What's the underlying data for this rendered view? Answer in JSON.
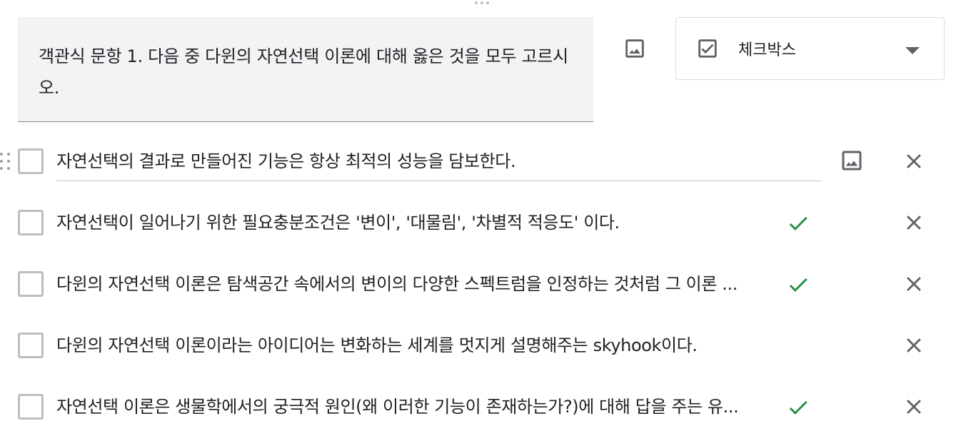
{
  "question": {
    "text": "객관식 문항 1. 다음 중 다윈의 자연선택 이론에 대해 옳은 것을 모두 고르시오.",
    "image_button_icon": "image-icon"
  },
  "question_type": {
    "label": "체크박스",
    "icon": "checkbox-checked-icon",
    "caret_icon": "caret-down-icon"
  },
  "options": [
    {
      "text": "자연선택의 결과로 만들어진 기능은 항상 최적의 성능을 담보한다.",
      "correct": false
    },
    {
      "text": "자연선택이 일어나기 위한 필요충분조건은 '변이', '대물림', '차별적 적응도' 이다.",
      "correct": true
    },
    {
      "text": "다윈의 자연선택 이론은 탐색공간 속에서의  변이의 다양한 스펙트럼을 인정하는 것처럼 그 이론 ...",
      "correct": true
    },
    {
      "text": "다윈의 자연선택 이론이라는 아이디어는 변화하는 세계를 멋지게 설명해주는 skyhook이다.",
      "correct": false
    },
    {
      "text": "자연선택 이론은 생물학에서의 궁극적 원인(왜 이러한 기능이 존재하는가?)에 대해 답을 주는 유...",
      "correct": true
    }
  ],
  "colors": {
    "check_green": "#1e8e3e",
    "icon_gray": "#5f6368",
    "question_bg": "#f1f3f4"
  }
}
